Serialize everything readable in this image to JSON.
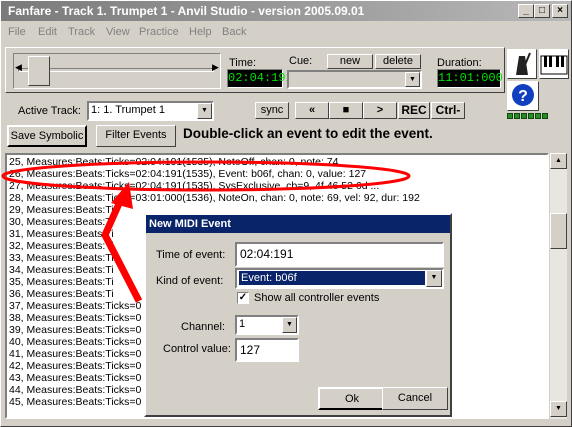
{
  "window": {
    "title": "Fanfare - Track 1. Trumpet 1 - Anvil Studio - version 2005.09.01"
  },
  "menu": [
    "File",
    "Edit",
    "Track",
    "View",
    "Practice",
    "Help",
    "Back"
  ],
  "transport": {
    "time_label": "Time:",
    "time_value": "02:04:191",
    "cue_label": "Cue:",
    "new_label": "new",
    "delete_label": "delete",
    "cue_value": "",
    "duration_label": "Duration:",
    "duration_value": "11:01:000"
  },
  "track_bar": {
    "active_track_label": "Active Track:",
    "active_track_value": "1: 1. Trumpet 1",
    "sync_label": "sync",
    "rewind_label": "«",
    "stop_label": "■",
    "play_label": ">",
    "rec_label": "REC",
    "ctrl_label": "Ctrl-"
  },
  "actions": {
    "save_symbolic": "Save Symbolic",
    "filter_events": "Filter Events",
    "hint": "Double-click an event to edit the event."
  },
  "events": [
    "25, Measures:Beats:Ticks=02:04:191(1535), NoteOff, chan: 0, note: 74",
    "26, Measures:Beats:Ticks=02:04:191(1535), Event: b06f, chan: 0, value: 127",
    "27, Measures:Beats:Ticks=02:04:191(1535), SysExclusive, cb=9, 4f 46 52 6d ...",
    "28, Measures:Beats:Ticks=03:01:000(1536), NoteOn, chan: 0, note: 69, vel: 92, dur: 192",
    "29, Measures:Beats:Ti",
    "30, Measures:Beats:Ti",
    "31, Measures:Beats:Ti",
    "32, Measures:Beats:Ti",
    "33, Measures:Beats:Ti",
    "34, Measures:Beats:Ti",
    "35, Measures:Beats:Ti",
    "36, Measures:Beats:Ti",
    "37, Measures:Beats:Ticks=0",
    "38, Measures:Beats:Ticks=0",
    "39, Measures:Beats:Ticks=0",
    "40, Measures:Beats:Ticks=0",
    "41, Measures:Beats:Ticks=0",
    "42, Measures:Beats:Ticks=0",
    "43, Measures:Beats:Ticks=0",
    "44, Measures:Beats:Ticks=0",
    "45, Measures:Beats:Ticks=0"
  ],
  "dialog": {
    "title": "New MIDI Event",
    "time_label": "Time of event:",
    "time_value": "02:04:191",
    "kind_label": "Kind of event:",
    "kind_value": "Event: b06f",
    "show_all_label": "Show all controller events",
    "show_all_checked": true,
    "channel_label": "Channel:",
    "channel_value": "1",
    "control_label": "Control value:",
    "control_value": "127",
    "ok_label": "Ok",
    "cancel_label": "Cancel"
  },
  "colors": {
    "annotation_red": "#ff0000",
    "dialog_title_bg": "#0a246a",
    "lcd_text": "#00e000"
  }
}
